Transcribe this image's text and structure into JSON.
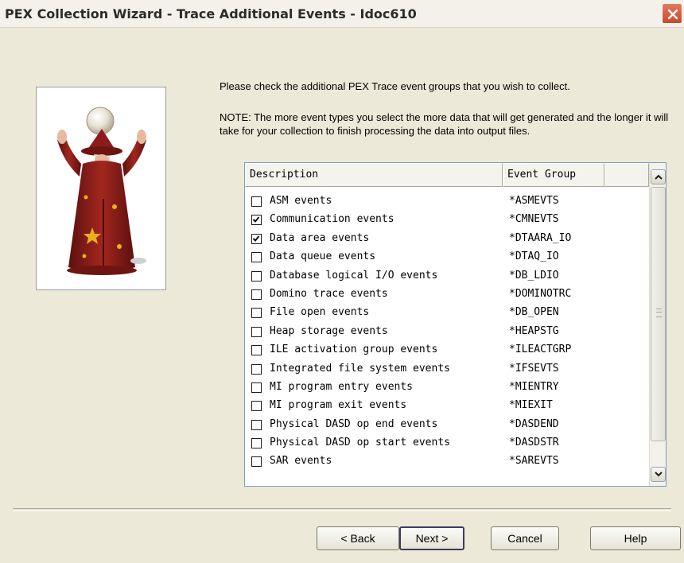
{
  "window": {
    "title": "PEX Collection Wizard - Trace Additional Events - Idoc610"
  },
  "content": {
    "instruction": "Please check the additional PEX Trace event groups that you wish to collect.",
    "note": "NOTE:  The more event types you select the more data that will get generated and the longer it will take for your collection to finish processing the data into output files."
  },
  "table": {
    "headers": {
      "description": "Description",
      "event_group": "Event Group"
    },
    "rows": [
      {
        "description": "ASM events",
        "group": "*ASMEVTS",
        "checked": false
      },
      {
        "description": "Communication events",
        "group": "*CMNEVTS",
        "checked": true
      },
      {
        "description": "Data area events",
        "group": "*DTAARA_IO",
        "checked": true
      },
      {
        "description": "Data queue events",
        "group": "*DTAQ_IO",
        "checked": false
      },
      {
        "description": "Database logical I/O events",
        "group": "*DB_LDIO",
        "checked": false
      },
      {
        "description": "Domino trace events",
        "group": "*DOMINOTRC",
        "checked": false
      },
      {
        "description": "File open events",
        "group": "*DB_OPEN",
        "checked": false
      },
      {
        "description": "Heap storage events",
        "group": "*HEAPSTG",
        "checked": false
      },
      {
        "description": "ILE activation group events",
        "group": "*ILEACTGRP",
        "checked": false
      },
      {
        "description": "Integrated file system events",
        "group": "*IFSEVTS",
        "checked": false
      },
      {
        "description": "MI program entry events",
        "group": "*MIENTRY",
        "checked": false
      },
      {
        "description": "MI program exit events",
        "group": "*MIEXIT",
        "checked": false
      },
      {
        "description": "Physical DASD op end events",
        "group": "*DASDEND",
        "checked": false
      },
      {
        "description": "Physical DASD op start events",
        "group": "*DASDSTR",
        "checked": false
      },
      {
        "description": "SAR events",
        "group": "*SAREVTS",
        "checked": false
      }
    ]
  },
  "buttons": {
    "back": "< Back",
    "next": "Next >",
    "cancel": "Cancel",
    "help": "Help"
  }
}
